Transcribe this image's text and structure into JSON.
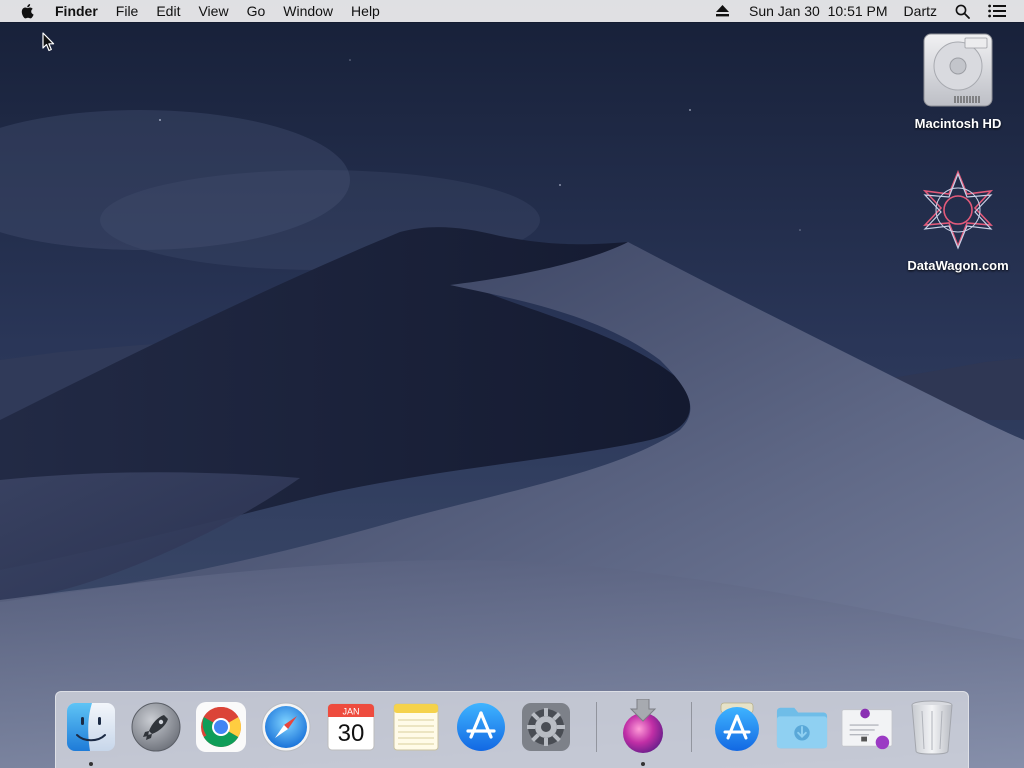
{
  "menubar": {
    "app_name": "Finder",
    "menus": [
      "File",
      "Edit",
      "View",
      "Go",
      "Window",
      "Help"
    ],
    "datetime": "Sun Jan 30  10:51 PM",
    "user": "Dartz",
    "status_icons": [
      "eject-icon",
      "spotlight-search-icon",
      "notification-center-icon"
    ]
  },
  "desktop": {
    "icons": [
      {
        "label": "Macintosh HD",
        "icon": "hard-drive-icon"
      },
      {
        "label": "DataWagon.com",
        "icon": "datawagon-logo-icon"
      }
    ]
  },
  "dock": {
    "calendar_month": "JAN",
    "calendar_day": "30",
    "items": [
      {
        "name": "Finder",
        "icon": "finder-icon",
        "running": true
      },
      {
        "name": "Launchpad",
        "icon": "launchpad-rocket-icon",
        "running": false
      },
      {
        "name": "Google Chrome",
        "icon": "chrome-icon",
        "running": false
      },
      {
        "name": "Safari",
        "icon": "safari-compass-icon",
        "running": false
      },
      {
        "name": "Calendar",
        "icon": "calendar-icon",
        "running": false
      },
      {
        "name": "Notes",
        "icon": "notes-icon",
        "running": false
      },
      {
        "name": "App Store",
        "icon": "app-store-icon",
        "running": false
      },
      {
        "name": "System Preferences",
        "icon": "gear-icon",
        "running": false
      },
      {
        "name": "Installer",
        "icon": "installer-icon",
        "running": true
      },
      {
        "name": "App Store Downloads",
        "icon": "app-store-download-icon",
        "running": false
      },
      {
        "name": "Downloads",
        "icon": "downloads-folder-icon",
        "running": false
      },
      {
        "name": "Document Preview",
        "icon": "document-preview-icon",
        "running": false
      },
      {
        "name": "Trash",
        "icon": "trash-icon",
        "running": false
      }
    ]
  },
  "colors": {
    "menubar_bg": "#e8e8ea",
    "sky_top": "#1c2640",
    "sky_bottom": "#3a4766",
    "dune_light": "#6b7491",
    "dune_dark": "#262f4c",
    "dock_bg": "#d7dae2"
  }
}
